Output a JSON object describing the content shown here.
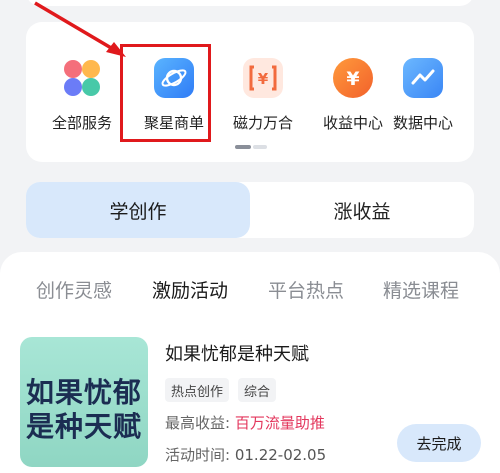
{
  "services": [
    {
      "label": "全部服务",
      "icon": "all-services-icon"
    },
    {
      "label": "聚星商单",
      "icon": "planet-icon"
    },
    {
      "label": "磁力万合",
      "icon": "yuan-bracket-icon"
    },
    {
      "label": "收益中心",
      "icon": "yuan-coin-icon"
    },
    {
      "label": "数据中心",
      "icon": "chart-line-icon"
    }
  ],
  "segment": {
    "learn": "学创作",
    "earn": "涨收益"
  },
  "tabs": [
    "创作灵感",
    "激励活动",
    "平台热点",
    "精选课程"
  ],
  "activity": {
    "thumb_line1": "如果忧郁",
    "thumb_line2": "是种天赋",
    "title": "如果忧郁是种天赋",
    "tags": [
      "热点创作",
      "综合"
    ],
    "reward_label": "最高收益:",
    "reward_value": "百万流量助推",
    "time_label": "活动时间:",
    "time_value": "01.22-02.05",
    "button": "去完成"
  },
  "colors": {
    "accent_red": "#e0191c",
    "reward": "#e3375d",
    "segment_active": "#d8e8fb"
  }
}
